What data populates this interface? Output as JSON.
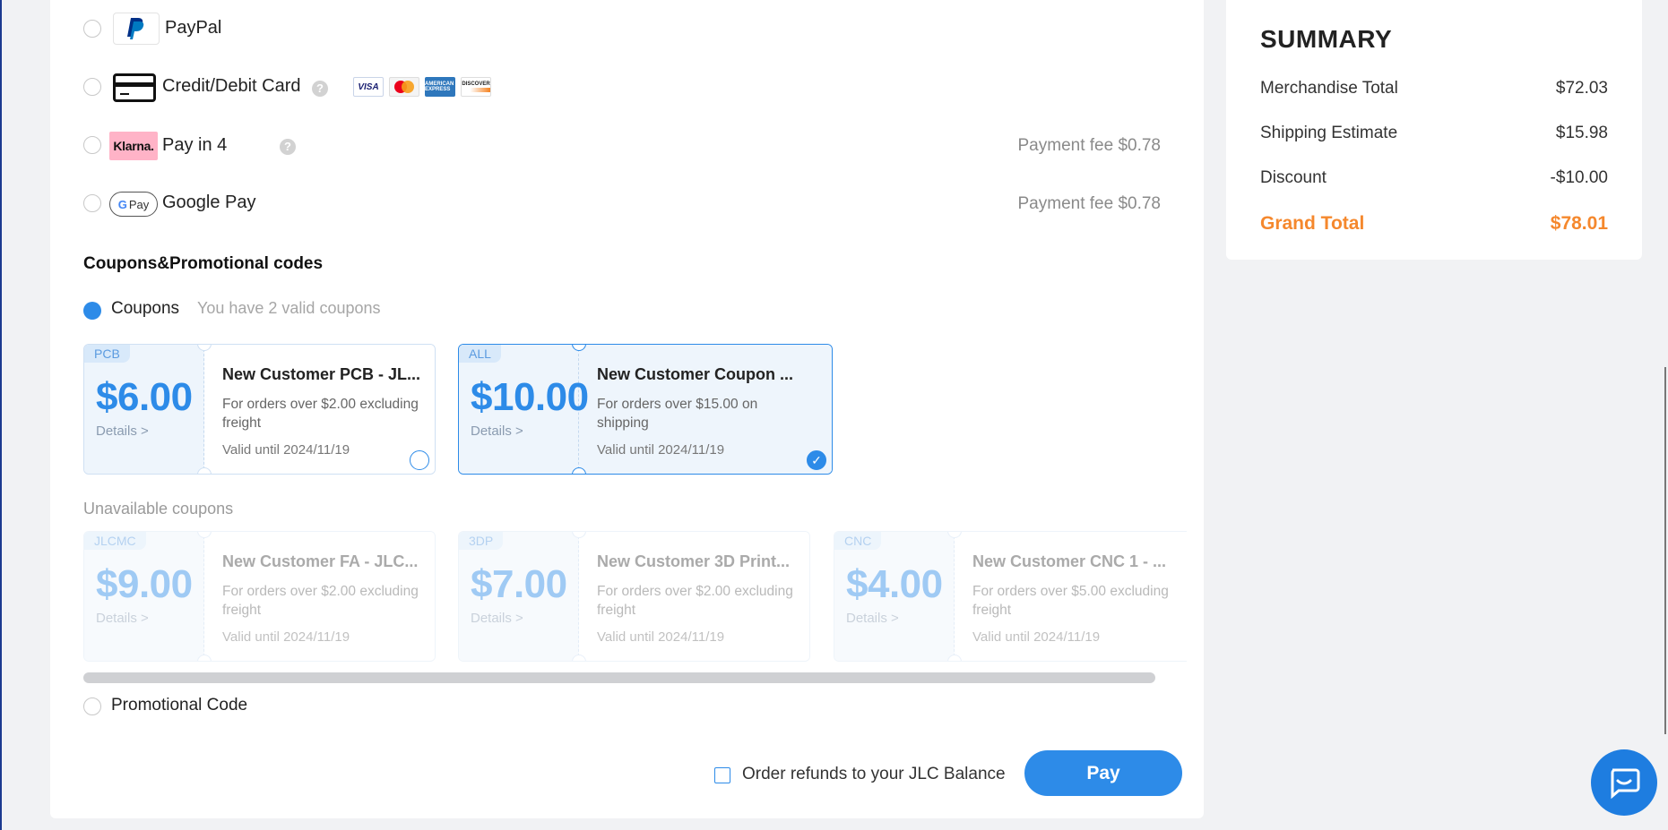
{
  "payment_methods": [
    {
      "label": "PayPal",
      "fee": ""
    },
    {
      "label": "Credit/Debit Card",
      "fee": ""
    },
    {
      "label": "Pay in 4",
      "fee": "Payment fee $0.78"
    },
    {
      "label": "Google Pay",
      "fee": "Payment fee $0.78"
    }
  ],
  "logos": {
    "klarna": "Klarna.",
    "gpay": "Pay",
    "gpay_g": "G",
    "visa": "VISA",
    "amex": "AMERICAN EXPRESS",
    "discover": "DISCOVER"
  },
  "help_icon_glyph": "?",
  "coupons_section": {
    "title": "Coupons&Promotional codes",
    "coupons_label": "Coupons",
    "coupons_hint": "You have 2 valid coupons",
    "unavailable_label": "Unavailable coupons",
    "promo_label": "Promotional Code"
  },
  "available_coupons": [
    {
      "tag": "PCB",
      "amount": "$6.00",
      "details": "Details >",
      "title": "New Customer PCB - JL...",
      "condition": "For orders over $2.00 excluding freight",
      "valid": "Valid until 2024/11/19",
      "selected": false
    },
    {
      "tag": "ALL",
      "amount": "$10.00",
      "details": "Details >",
      "title": "New Customer Coupon ...",
      "condition": "For orders over $15.00 on shipping",
      "valid": "Valid until 2024/11/19",
      "selected": true
    }
  ],
  "unavailable_coupons": [
    {
      "tag": "JLCMC",
      "amount": "$9.00",
      "details": "Details >",
      "title": "New Customer FA - JLC...",
      "condition": "For orders over $2.00 excluding freight",
      "valid": "Valid until 2024/11/19"
    },
    {
      "tag": "3DP",
      "amount": "$7.00",
      "details": "Details >",
      "title": "New Customer 3D Print...",
      "condition": "For orders over $2.00 excluding freight",
      "valid": "Valid until 2024/11/19"
    },
    {
      "tag": "CNC",
      "amount": "$4.00",
      "details": "Details >",
      "title": "New Customer CNC 1 - ...",
      "condition": "For orders over $5.00 excluding freight",
      "valid": "Valid until 2024/11/19"
    }
  ],
  "footer": {
    "refund_label": "Order refunds to your JLC Balance",
    "pay_label": "Pay"
  },
  "summary": {
    "title": "SUMMARY",
    "rows": [
      {
        "label": "Merchandise Total",
        "value": "$72.03"
      },
      {
        "label": "Shipping Estimate",
        "value": "$15.98"
      },
      {
        "label": "Discount",
        "value": "-$10.00"
      }
    ],
    "grand_total_label": "Grand Total",
    "grand_total_value": "$78.01"
  },
  "colors": {
    "accent": "#2d8be8",
    "total": "#f5882d"
  },
  "icons": [
    "paypal-icon",
    "credit-card-icon",
    "klarna-icon",
    "google-pay-icon",
    "help-icon",
    "checkmark-icon",
    "chat-icon"
  ]
}
